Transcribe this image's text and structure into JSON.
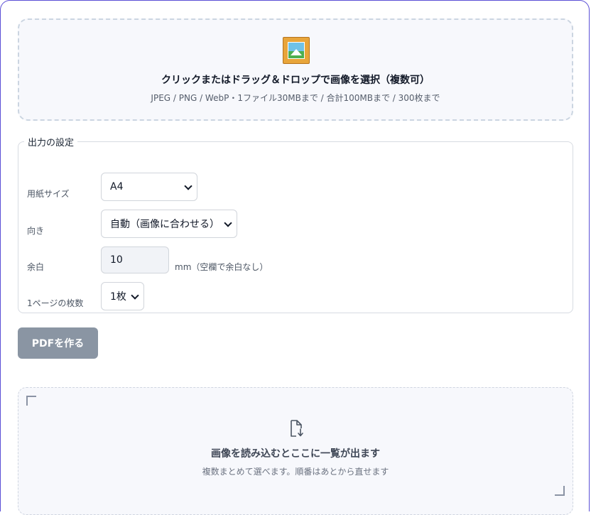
{
  "upload": {
    "title": "クリックまたはドラッグ＆ドロップで画像を選択（複数可）",
    "subtitle": "JPEG / PNG / WebP・1ファイル30MBまで / 合計100MBまで / 300枚まで",
    "icon": "framed-picture-icon"
  },
  "settings": {
    "legend": "出力の設定",
    "paper_size": {
      "label": "用紙サイズ",
      "value": "A4"
    },
    "orientation": {
      "label": "向き",
      "value": "自動（画像に合わせる）"
    },
    "margin": {
      "label": "余白",
      "value": "10",
      "unit": "mm（空欄で余白なし）"
    },
    "per_page": {
      "label": "1ページの枚数",
      "value": "1枚"
    }
  },
  "actions": {
    "make_pdf": "PDFを作る"
  },
  "preview": {
    "icon": "document-arrow-down-icon",
    "title": "画像を読み込むとここに一覧が出ます",
    "subtitle": "複数まとめて選べます。順番はあとから直せます"
  },
  "colors": {
    "card_border": "#5b4fd6",
    "button_disabled": "#8a95a3"
  }
}
